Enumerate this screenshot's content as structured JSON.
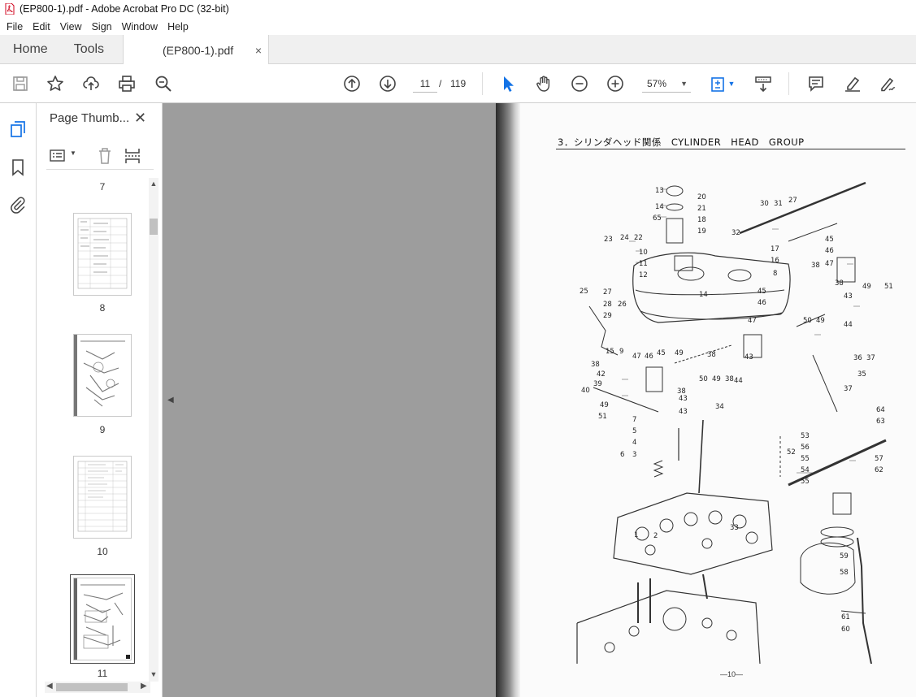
{
  "window": {
    "title": "(EP800-1).pdf - Adobe Acrobat Pro DC (32-bit)"
  },
  "menu": {
    "items": [
      "File",
      "Edit",
      "View",
      "Sign",
      "Window",
      "Help"
    ]
  },
  "tabs": {
    "home": "Home",
    "tools": "Tools",
    "document": "(EP800-1).pdf",
    "close": "×"
  },
  "toolbar": {
    "current_page": "11",
    "page_separator": "/",
    "total_pages": "119",
    "zoom": "57%",
    "icons": [
      "save-icon",
      "bookmark-star-icon",
      "upload-icon",
      "print-icon",
      "search-zoom-icon",
      "prev-page-icon",
      "next-page-icon",
      "select-cursor-icon",
      "hand-icon",
      "zoom-out-icon",
      "zoom-in-icon",
      "fit-page-icon",
      "scroll-mode-icon",
      "comment-icon",
      "highlight-icon",
      "sign-icon"
    ]
  },
  "sidebar": {
    "panel_title": "Page Thumb...",
    "close": "✕",
    "thumbnails": [
      {
        "label": "7"
      },
      {
        "label": "8"
      },
      {
        "label": "9"
      },
      {
        "label": "10"
      },
      {
        "label": "11",
        "selected": true
      }
    ]
  },
  "document": {
    "header": "3．シリンダヘッド関係　CYLINDER　HEAD　GROUP",
    "footer": "—10—",
    "callouts": [
      "13",
      "14",
      "65",
      "20",
      "21",
      "18",
      "19",
      "30",
      "31",
      "27",
      "23",
      "24",
      "22",
      "10",
      "11",
      "12",
      "32",
      "17",
      "16",
      "8",
      "45",
      "46",
      "47",
      "38",
      "49",
      "51",
      "25",
      "27",
      "28",
      "29",
      "26",
      "14",
      "45",
      "46",
      "47",
      "50",
      "49",
      "43",
      "44",
      "15",
      "9",
      "47",
      "46",
      "45",
      "49",
      "38",
      "42",
      "39",
      "40",
      "49",
      "51",
      "43",
      "43",
      "50",
      "49",
      "38",
      "44",
      "38",
      "44",
      "36",
      "37",
      "35",
      "37",
      "34",
      "7",
      "5",
      "4",
      "6",
      "3",
      "53",
      "56",
      "55",
      "54",
      "55",
      "52",
      "64",
      "63",
      "57",
      "62",
      "1",
      "2",
      "33",
      "59",
      "58",
      "61",
      "60"
    ]
  },
  "colors": {
    "accent": "#1473e6",
    "pdf_red": "#d0021b",
    "doc_background": "#9d9d9d"
  }
}
